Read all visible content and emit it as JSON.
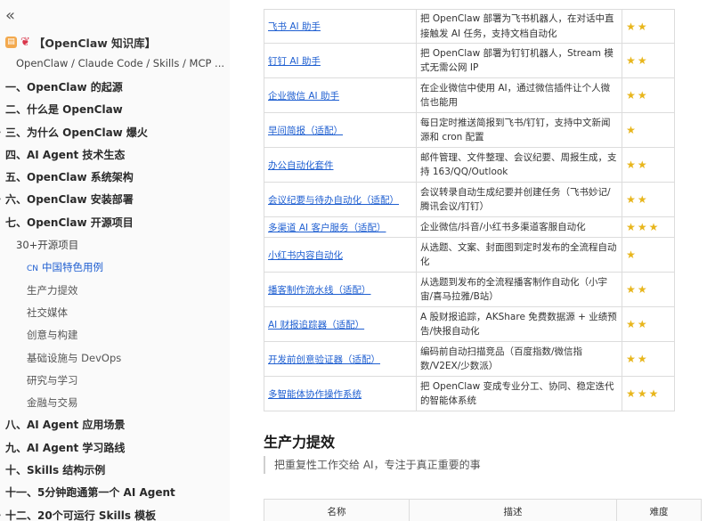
{
  "sidebar": {
    "collapse_icon": "chevrons-left-icon",
    "kb_title": "【OpenClaw 知识库】",
    "kb_subtitle": "OpenClaw / Claude Code / Skills / MCP ...",
    "items": [
      {
        "label": "一、OpenClaw 的起源",
        "level": 1
      },
      {
        "label": "二、什么是 OpenClaw",
        "level": 1
      },
      {
        "label": "三、为什么 OpenClaw 爆火",
        "level": 1,
        "arrow": true
      },
      {
        "label": "四、AI Agent 技术生态",
        "level": 1
      },
      {
        "label": "五、OpenClaw 系统架构",
        "level": 1
      },
      {
        "label": "六、OpenClaw 安装部署",
        "level": 1,
        "arrow": true
      },
      {
        "label": "七、OpenClaw 开源项目",
        "level": 1
      },
      {
        "label": "30+开源项目",
        "level": 2
      },
      {
        "label": "中国特色用例",
        "level": 3,
        "active": true,
        "badge": "CN"
      },
      {
        "label": "生产力提效",
        "level": 3
      },
      {
        "label": "社交媒体",
        "level": 3
      },
      {
        "label": "创意与构建",
        "level": 3
      },
      {
        "label": "基础设施与 DevOps",
        "level": 3
      },
      {
        "label": "研究与学习",
        "level": 3
      },
      {
        "label": "金融与交易",
        "level": 3
      },
      {
        "label": "八、AI Agent 应用场景",
        "level": 1
      },
      {
        "label": "九、AI Agent 学习路线",
        "level": 1
      },
      {
        "label": "十、Skills 结构示例",
        "level": 1
      },
      {
        "label": "十一、5分钟跑通第一个 AI Agent",
        "level": 1
      },
      {
        "label": "十二、20个可运行 Skills 模板",
        "level": 1,
        "arrow": true
      }
    ]
  },
  "tools": [
    {
      "name": "飞书 AI 助手",
      "desc": "把 OpenClaw 部署为飞书机器人，在对话中直接触发 AI 任务，支持文档自动化",
      "stars": 2
    },
    {
      "name": "钉钉 AI 助手",
      "desc": "把 OpenClaw 部署为钉钉机器人，Stream 模式无需公网 IP",
      "stars": 2
    },
    {
      "name": "企业微信 AI 助手",
      "desc": "在企业微信中使用 AI，通过微信插件让个人微信也能用",
      "stars": 2
    },
    {
      "name": "早间简报（适配）",
      "desc": "每日定时推送简报到飞书/钉钉，支持中文新闻源和 cron 配置",
      "stars": 1
    },
    {
      "name": "办公自动化套件",
      "desc": "邮件管理、文件整理、会议纪要、周报生成，支持 163/QQ/Outlook",
      "stars": 2
    },
    {
      "name": "会议纪要与待办自动化（适配）",
      "desc": "会议转录自动生成纪要并创建任务（飞书妙记/腾讯会议/钉钉）",
      "stars": 2
    },
    {
      "name": "多渠道 AI 客户服务（适配）",
      "desc": "企业微信/抖音/小红书多渠道客服自动化",
      "stars": 3
    },
    {
      "name": "小红书内容自动化",
      "desc": "从选题、文案、封面图到定时发布的全流程自动化",
      "stars": 1
    },
    {
      "name": "播客制作流水线（适配）",
      "desc": "从选题到发布的全流程播客制作自动化（小宇宙/喜马拉雅/B站）",
      "stars": 2
    },
    {
      "name": "AI 财报追踪器（适配）",
      "desc": "A 股财报追踪，AKShare 免费数据源 + 业绩预告/快报自动化",
      "stars": 2
    },
    {
      "name": "开发前创意验证器（适配）",
      "desc": "编码前自动扫描竞品（百度指数/微信指数/V2EX/少数派）",
      "stars": 2
    },
    {
      "name": "多智能体协作操作系统",
      "desc": "把 OpenClaw 变成专业分工、协同、稳定迭代的智能体系统",
      "stars": 3
    }
  ],
  "section": {
    "title": "生产力提效",
    "quote": "把重复性工作交给 AI，专注于真正重要的事"
  },
  "bottom_table": {
    "headers": [
      "名称",
      "描述",
      "难度"
    ]
  },
  "colors": {
    "link": "#1f5fd1",
    "star": "#e8b61c",
    "title_icon": "#d9354a"
  }
}
